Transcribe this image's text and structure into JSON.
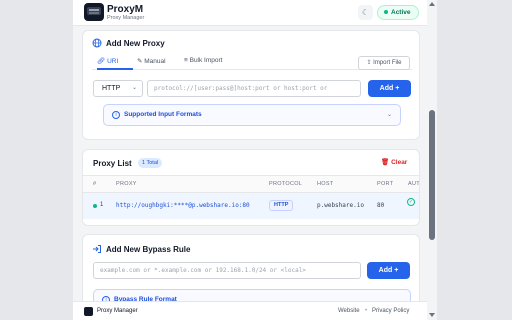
{
  "header": {
    "title": "ProxyM",
    "subtitle": "Proxy Manager",
    "theme_icon": "moon-icon",
    "status": "Active",
    "status_color": "#10b981"
  },
  "add_proxy": {
    "title": "Add New Proxy",
    "tabs": [
      {
        "label": "URI",
        "icon": "link-icon",
        "active": true
      },
      {
        "label": "Manual",
        "icon": "edit-icon",
        "active": false
      },
      {
        "label": "Bulk Import",
        "icon": "list-icon",
        "active": false
      }
    ],
    "import_label": "Import File",
    "protocol_value": "HTTP",
    "uri_placeholder": "protocol://[user:pass@]host:port  or  host:port  or",
    "add_label": "Add +",
    "formats_label": "Supported Input Formats"
  },
  "proxy_list": {
    "title": "Proxy List",
    "count_badge": "1 Total",
    "clear_label": "Clear",
    "columns": [
      "#",
      "PROXY",
      "PROTOCOL",
      "HOST",
      "PORT",
      "AUT"
    ],
    "rows": [
      {
        "index": "1",
        "proxy": "http://oughbgki:****@p.webshare.io:80",
        "protocol": "HTTP",
        "host": "p.webshare.io",
        "port": "80",
        "status_color": "#10b981"
      }
    ]
  },
  "bypass": {
    "title": "Add New Bypass Rule",
    "placeholder": "example.com or *.example.com or 192.168.1.0/24 or <local>",
    "add_label": "Add +",
    "formats_label": "Bypass Rule Format"
  },
  "footer": {
    "name": "Proxy Manager",
    "link_website": "Website",
    "separator": "•",
    "link_privacy": "Privacy Policy"
  },
  "colors": {
    "accent": "#2563eb",
    "danger": "#dc2626",
    "success": "#10b981"
  }
}
